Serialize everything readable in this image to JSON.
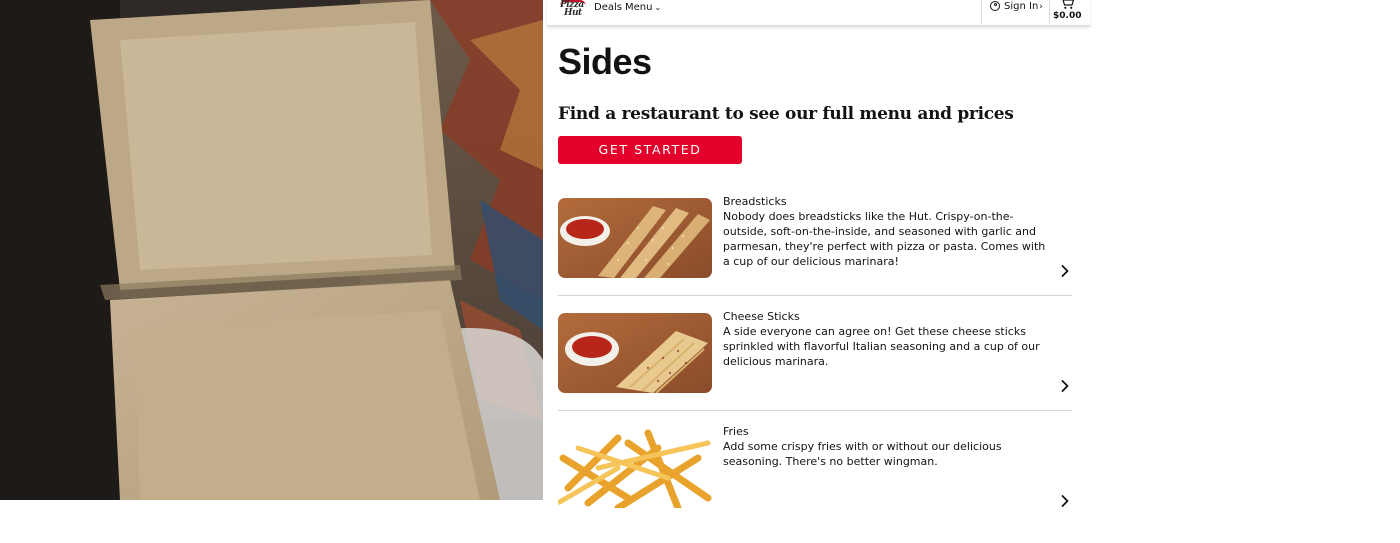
{
  "header": {
    "logo_line1": "Pizza",
    "logo_line2": "Hut",
    "nav": {
      "deals": "Deals",
      "menu": "Menu"
    },
    "sign_in": "Sign In",
    "cart_total": "$0.00",
    "icons": [
      "user-icon",
      "cart-icon",
      "chevron-down-icon",
      "chevron-right-icon"
    ]
  },
  "main": {
    "title": "Sides",
    "find_heading": "Find a restaurant to see our full menu and prices",
    "cta_label": "GET STARTED"
  },
  "products": [
    {
      "name": "Breadsticks",
      "description": "Nobody does breadsticks like the Hut. Crispy-on-the-outside, soft-on-the-inside, and seasoned with garlic and parmesan, they're perfect with pizza or pasta. Comes with a cup of our delicious marinara!"
    },
    {
      "name": "Cheese Sticks",
      "description": "A side everyone can agree on! Get these cheese sticks sprinkled with flavorful Italian seasoning and a cup of our delicious marinara."
    },
    {
      "name": "Fries",
      "description": "Add some crispy fries with or without our delicious seasoning. There's no better wingman."
    }
  ],
  "colors": {
    "brand_red": "#e4002b",
    "text": "#131313",
    "divider": "#d6d6d6"
  }
}
